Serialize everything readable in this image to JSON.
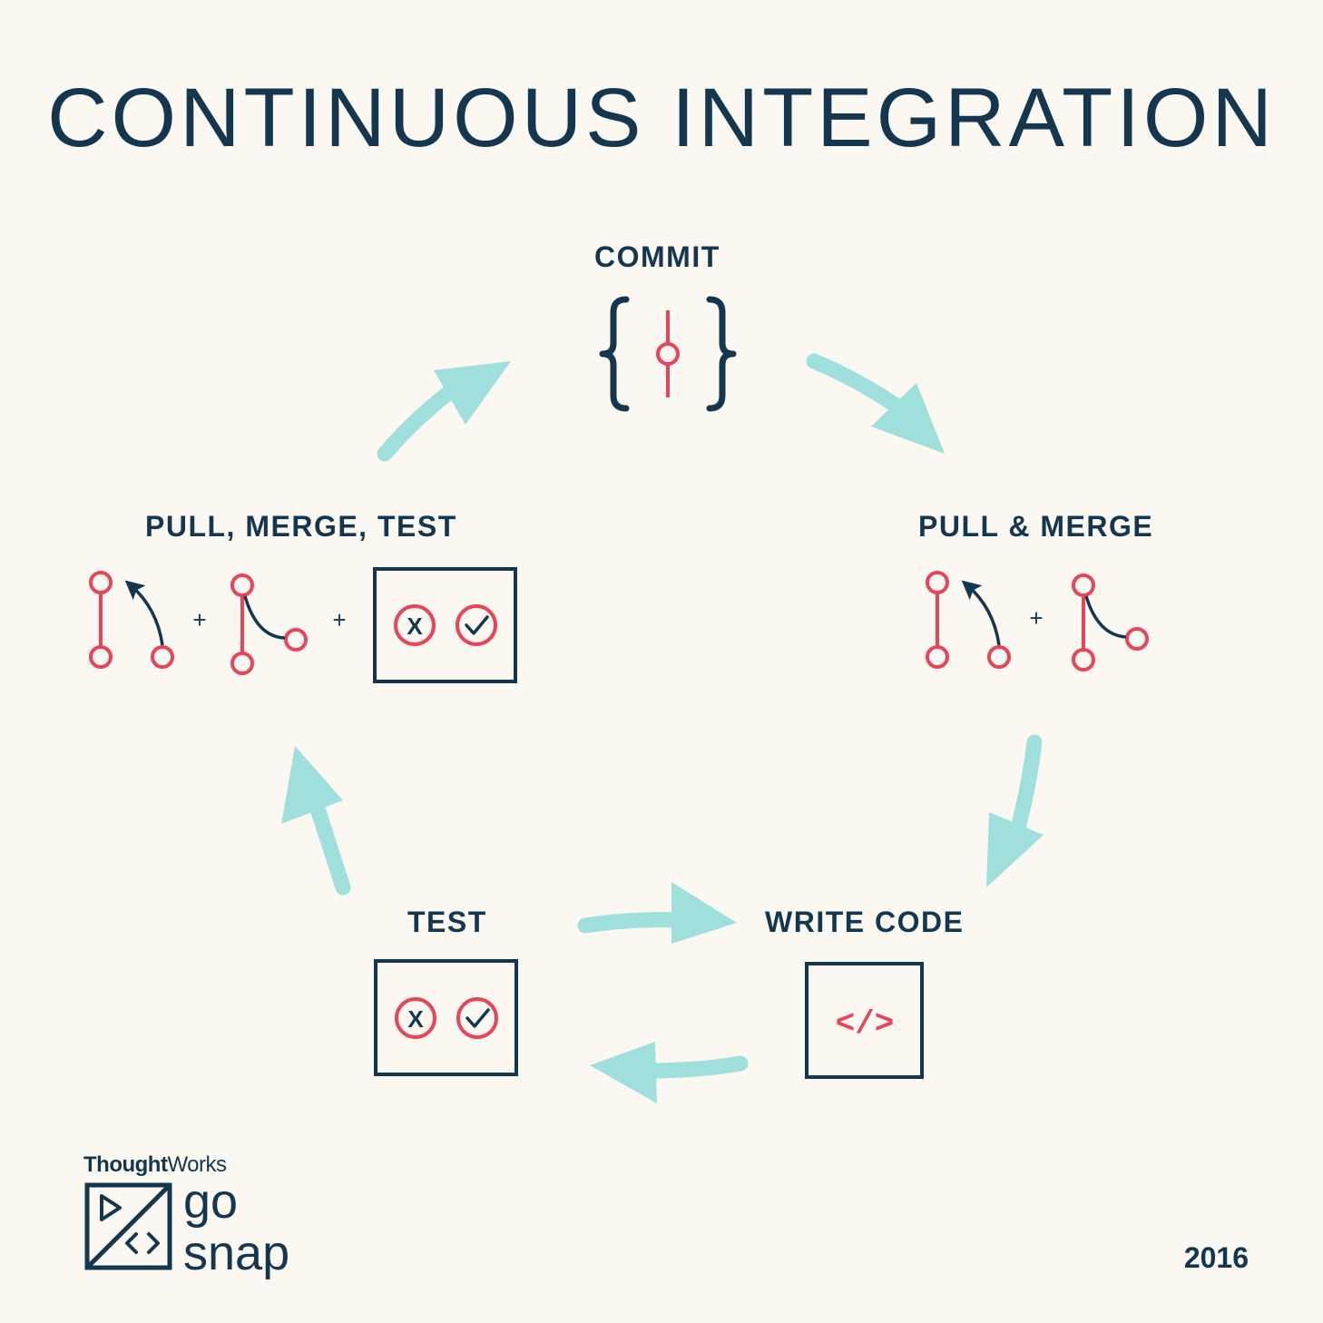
{
  "title": "CONTINUOUS INTEGRATION",
  "stages": {
    "commit": "COMMIT",
    "pull_merge": "PULL & MERGE",
    "write_code": "WRITE CODE",
    "test": "TEST",
    "pull_merge_test": "PULL, MERGE, TEST"
  },
  "icons": {
    "plus": "+",
    "code": "</>",
    "fail": "X"
  },
  "brand": {
    "company_bold": "Thought",
    "company_regular": "Works",
    "product_line1": "go",
    "product_line2": "snap"
  },
  "year": "2016",
  "colors": {
    "navy": "#14374f",
    "red": "#e8445a",
    "teal": "#9fe0dc",
    "background": "#fbf8f1"
  }
}
